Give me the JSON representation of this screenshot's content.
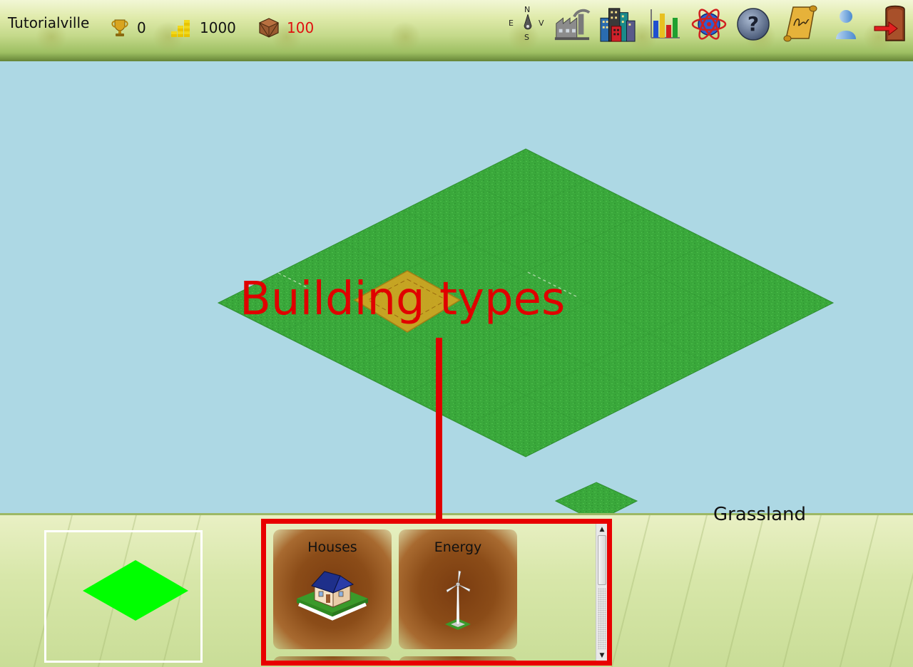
{
  "topbar": {
    "city_name": "Tutorialville",
    "stats": [
      {
        "name": "trophy",
        "icon": "trophy-icon",
        "value": "0",
        "color": "#111111"
      },
      {
        "name": "money",
        "icon": "gold-coins-icon",
        "value": "1000",
        "color": "#111111"
      },
      {
        "name": "materials",
        "icon": "crate-icon",
        "value": "100",
        "color": "#e01010"
      }
    ],
    "compass": {
      "north": "N",
      "south": "S",
      "east": "E",
      "west": "V",
      "icon": "compass-icon"
    },
    "tools": [
      {
        "name": "industry",
        "icon": "factory-icon"
      },
      {
        "name": "buildings",
        "icon": "city-buildings-icon"
      },
      {
        "name": "statistics",
        "icon": "bar-chart-icon"
      },
      {
        "name": "research",
        "icon": "atom-icon"
      },
      {
        "name": "help",
        "icon": "question-mark-icon"
      },
      {
        "name": "journal",
        "icon": "scroll-icon"
      },
      {
        "name": "profile",
        "icon": "user-icon"
      },
      {
        "name": "exit",
        "icon": "exit-door-icon"
      }
    ]
  },
  "map": {
    "annotation": "Building types",
    "terrain_name": "Grassland",
    "colors": {
      "sky": "#add8e4",
      "grass": "#39a83a",
      "highlight": "#d9a420",
      "annotation": "#e00000"
    }
  },
  "building_panel": {
    "categories": [
      {
        "label": "Houses",
        "icon": "house-icon"
      },
      {
        "label": "Energy",
        "icon": "wind-turbine-icon"
      }
    ],
    "preview_icon": "green-tile-icon"
  }
}
